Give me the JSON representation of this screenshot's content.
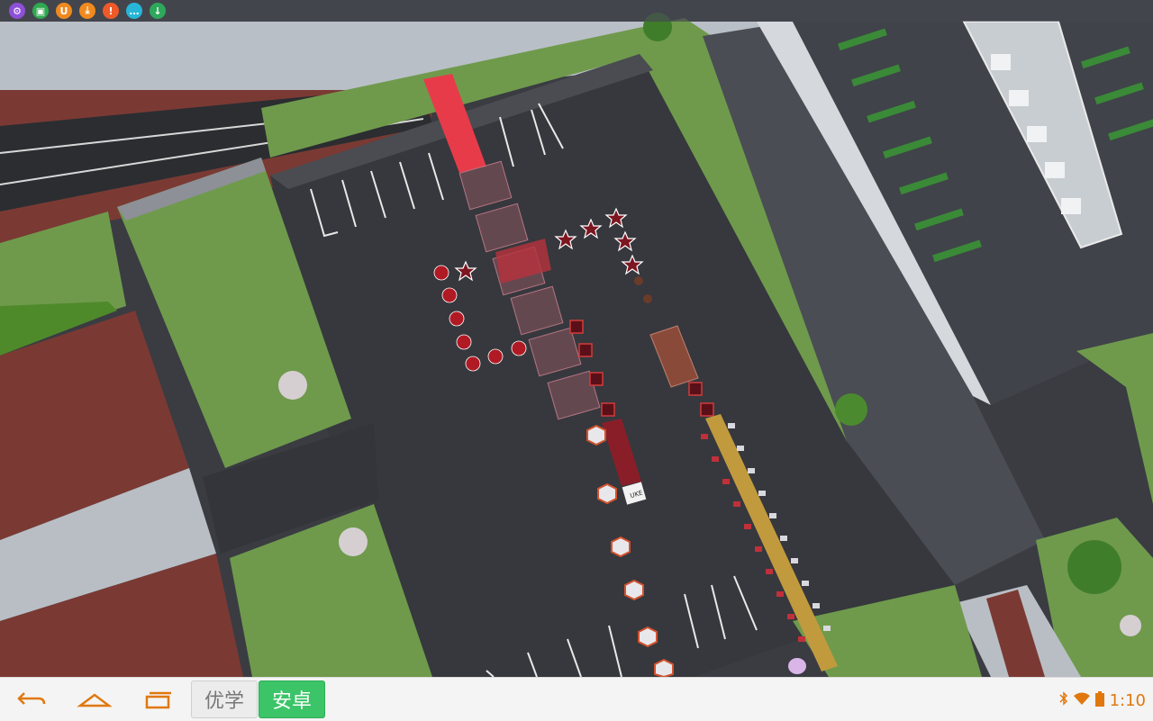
{
  "status_bar": {
    "icons": [
      {
        "name": "settings-gear-icon",
        "glyph": "⚙",
        "color": "#8e4fd8"
      },
      {
        "name": "photo-app-icon",
        "glyph": "▣",
        "color": "#2fa84f"
      },
      {
        "name": "u-app-icon",
        "glyph": "U",
        "color": "#f08a1e"
      },
      {
        "name": "download-arrow-icon",
        "glyph": "⤓",
        "color": "#f08a1e"
      },
      {
        "name": "alert-icon",
        "glyph": "!",
        "color": "#ef5a28"
      },
      {
        "name": "chat-bubble-icon",
        "glyph": "…",
        "color": "#27b6d8"
      },
      {
        "name": "download-circle-icon",
        "glyph": "↓",
        "color": "#2ea85a"
      }
    ]
  },
  "nav_bar": {
    "back_icon": "back-arrow-icon",
    "home_icon": "home-icon",
    "recents_icon": "recent-apps-icon",
    "tab_youxue": "优学",
    "tab_anzhuo": "安卓",
    "clock": "1:10",
    "accent_color": "#e0780e",
    "tray_icons": [
      "bluetooth-icon",
      "wifi-icon",
      "battery-icon"
    ]
  },
  "scene": {
    "sign_text": "UKE",
    "colors": {
      "asphalt": "#3a3c42",
      "grass": "#6f9a4c",
      "roof_brown": "#7a3a33",
      "decor_red": "#d22a2a"
    }
  }
}
